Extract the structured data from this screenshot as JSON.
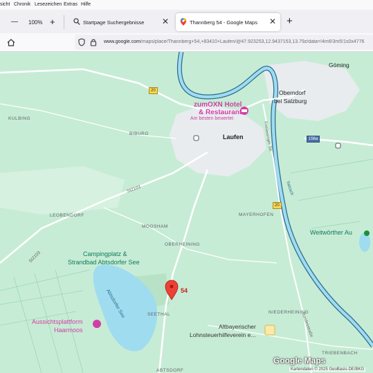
{
  "menu": {
    "items": [
      "sicht",
      "Chronik",
      "Lesezeichen",
      "Extras",
      "Hilfe"
    ]
  },
  "zoom": {
    "minus": "—",
    "level": "100%",
    "plus": "+"
  },
  "tabs": [
    {
      "title": "Startpage Suchergebnisse",
      "close": "✕"
    },
    {
      "title": "Thannberg 54 - Google Maps",
      "close": "✕"
    }
  ],
  "newtab": "+",
  "url": {
    "domain": "www.google.com",
    "path": "/maps/place/Thannberg+54,+83410+Laufen/@47.923253,12.9437153,13.79z/data=!4m6!3m5!1s0x4776"
  },
  "map": {
    "places": {
      "goming": "Göming",
      "oberndorf": "Oberndorf",
      "bei_salzburg": "bei Salzburg",
      "laufen": "Laufen",
      "kulbing": "KULBING",
      "biburg": "BIBURG",
      "leobendorf": "LEOBENDORF",
      "moosham": "MOOSHAM",
      "oberheining": "OBERHEINING",
      "mayerhofen": "MAYERHOFEN",
      "seethal": "SEETHAL",
      "niederheining": "NIEDERHEINING",
      "triebenbach": "TRIEBENBACH",
      "abtsdorf": "ABTSDORF"
    },
    "pois": {
      "hotel1": "zumOXN Hotel",
      "hotel2": "& Restaurant",
      "hotel_sub": "Am besten bewertet",
      "camping1": "Campingplatz &",
      "camping2": "Strandbad Abtsdorfer See",
      "aussicht1": "Aussichtsplattform",
      "aussicht2": "Haarmoos",
      "weitwoerther": "Weitwörther Au",
      "verein1": "Altbayerischer",
      "verein2": "Lohnsteuerhilfeverein e..."
    },
    "water": {
      "lake": "Abtsdorfer See",
      "river": "Salzach"
    },
    "roads": {
      "r20a": "20",
      "r20b": "20",
      "r156a": "156a",
      "st2103a": "St2103",
      "st2103b": "St2103",
      "strasse": "Freilassinger Str.",
      "bund": "Bundesstraße"
    },
    "pin_label": "54",
    "logo": "Google Maps",
    "attribution": "Kartendaten © 2025 GeoBasis-DE/BKG"
  },
  "colors": {
    "map_green": "#c7ecd5",
    "water": "#9fdcf0",
    "river": "#7cc9e6",
    "urban": "#e8ecee",
    "pin": "#ea4335",
    "pink_poi": "#d13fa6"
  }
}
